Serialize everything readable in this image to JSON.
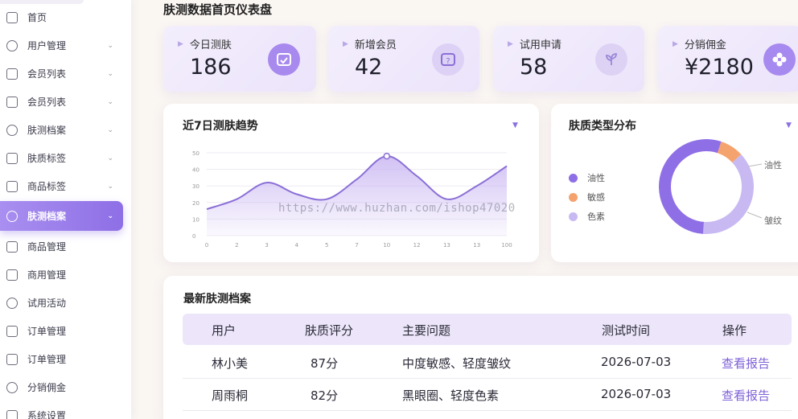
{
  "sidebar": {
    "items": [
      {
        "label": "首页",
        "icon": "home-icon",
        "chevron": false
      },
      {
        "label": "用户管理",
        "icon": "user-card-icon",
        "chevron": true
      },
      {
        "label": "会员列表",
        "icon": "member-icon",
        "chevron": true
      },
      {
        "label": "会员列表",
        "icon": "graduation-cap-icon",
        "chevron": true
      },
      {
        "label": "肤测档案",
        "icon": "file-icon",
        "chevron": true
      },
      {
        "label": "肤质标签",
        "icon": "shield-icon",
        "chevron": true
      },
      {
        "label": "商品标签",
        "icon": "tag-icon",
        "chevron": true
      },
      {
        "label": "肤测档案",
        "icon": "file-active-icon",
        "chevron": true,
        "active": true
      },
      {
        "label": "商品管理",
        "icon": "list-icon",
        "chevron": false
      },
      {
        "label": "商用管理",
        "icon": "heart-shield-icon",
        "chevron": false
      },
      {
        "label": "试用活动",
        "icon": "clock-icon",
        "chevron": false
      },
      {
        "label": "订单管理",
        "icon": "play-circle-icon",
        "chevron": false
      },
      {
        "label": "订单管理",
        "icon": "gift-icon",
        "chevron": false
      },
      {
        "label": "分销佣金",
        "icon": "wallet-icon",
        "chevron": false
      },
      {
        "label": "系统设置",
        "icon": "gear-icon",
        "chevron": false
      }
    ],
    "chevron_glyph": "⌄"
  },
  "page_title": "肤测数据首页仪表盘",
  "stats": [
    {
      "label": "今日测肤",
      "value": "186",
      "icon": "camera-scan-icon"
    },
    {
      "label": "新增会员",
      "value": "42",
      "icon": "question-card-icon"
    },
    {
      "label": "试用申请",
      "value": "58",
      "icon": "sprout-icon"
    },
    {
      "label": "分销佣金",
      "value": "¥2180",
      "icon": "flower-icon"
    }
  ],
  "trend": {
    "title": "近7日测肤趋势",
    "dropdown": "▼"
  },
  "chart_data": [
    {
      "type": "area",
      "title": "近7日测肤趋势",
      "x": [
        "0",
        "2",
        "3",
        "4",
        "5",
        "7",
        "10",
        "12",
        "13",
        "13",
        "100"
      ],
      "y_ticks": [
        "0",
        "10",
        "20",
        "30",
        "40",
        "50"
      ],
      "ylim": [
        0,
        50
      ],
      "values": [
        16,
        22,
        32,
        25,
        22,
        34,
        48,
        36,
        22,
        30,
        42
      ],
      "highlight_index": 6,
      "colors": {
        "line": "#8a6fd6",
        "fill": "#c9b6f2"
      },
      "grid": true
    },
    {
      "type": "pie",
      "title": "肤质类型分布",
      "labels": [
        "油性",
        "敏感",
        "色素"
      ],
      "values": [
        54,
        8,
        38
      ],
      "colors": [
        "#8f6fe6",
        "#f5a36e",
        "#c9b9f2"
      ],
      "legend_position": "left",
      "callouts": [
        "油性",
        "皱纹"
      ]
    }
  ],
  "distribution": {
    "title": "肤质类型分布",
    "dropdown": "▼",
    "legend": [
      {
        "label": "油性",
        "color": "#8f6fe6"
      },
      {
        "label": "敏感",
        "color": "#f5a36e"
      },
      {
        "label": "色素",
        "color": "#c9b9f2"
      }
    ],
    "callout_top": "油性",
    "callout_bottom": "皱纹"
  },
  "records": {
    "title": "最新肤测档案",
    "headers": [
      "用户",
      "肤质评分",
      "主要问题",
      "测试时间",
      "操作"
    ],
    "rows": [
      [
        "林小美",
        "87分",
        "中度敏感、轻度皱纹",
        "2026-07-03",
        "查看报告"
      ],
      [
        "周雨桐",
        "82分",
        "黑眼圈、轻度色素",
        "2026-07-03",
        "查看报告"
      ]
    ]
  },
  "watermark": "https://www.huzhan.com/ishop47020"
}
